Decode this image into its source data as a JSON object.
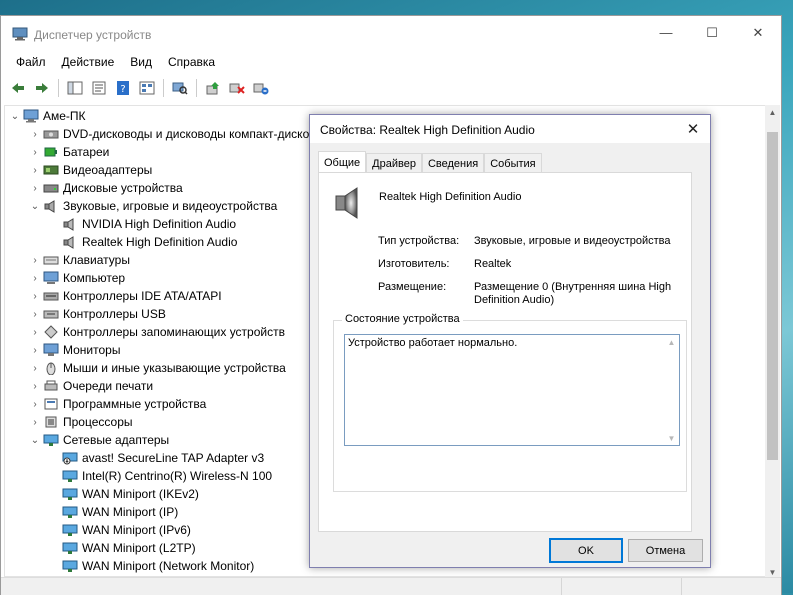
{
  "window": {
    "title": "Диспетчер устройств",
    "controls": {
      "minimize": "—",
      "maximize": "☐",
      "close": "✕"
    }
  },
  "menu": [
    "Файл",
    "Действие",
    "Вид",
    "Справка"
  ],
  "toolbar_icons": [
    "back-icon",
    "forward-icon",
    "show-hide-tree-icon",
    "properties-icon",
    "help-icon",
    "view-icon",
    "scan-hardware-icon",
    "update-driver-icon",
    "disable-device-icon",
    "uninstall-device-icon"
  ],
  "tree": {
    "root": "Аме-ПК",
    "items": [
      {
        "label": "DVD-дисководы и дисководы компакт-дисков",
        "level": 1,
        "expander": "›",
        "icon": "dvd-icon"
      },
      {
        "label": "Батареи",
        "level": 1,
        "expander": "›",
        "icon": "battery-icon"
      },
      {
        "label": "Видеоадаптеры",
        "level": 1,
        "expander": "›",
        "icon": "display-adapter-icon"
      },
      {
        "label": "Дисковые устройства",
        "level": 1,
        "expander": "›",
        "icon": "disk-drive-icon"
      },
      {
        "label": "Звуковые, игровые и видеоустройства",
        "level": 1,
        "expander": "⌄",
        "icon": "sound-icon"
      },
      {
        "label": "NVIDIA High Definition Audio",
        "level": 2,
        "expander": "",
        "icon": "speaker-icon"
      },
      {
        "label": "Realtek High Definition Audio",
        "level": 2,
        "expander": "",
        "icon": "speaker-icon"
      },
      {
        "label": "Клавиатуры",
        "level": 1,
        "expander": "›",
        "icon": "keyboard-icon"
      },
      {
        "label": "Компьютер",
        "level": 1,
        "expander": "›",
        "icon": "computer-icon"
      },
      {
        "label": "Контроллеры IDE ATA/ATAPI",
        "level": 1,
        "expander": "›",
        "icon": "ide-controller-icon"
      },
      {
        "label": "Контроллеры USB",
        "level": 1,
        "expander": "›",
        "icon": "usb-icon"
      },
      {
        "label": "Контроллеры запоминающих устройств",
        "level": 1,
        "expander": "›",
        "icon": "storage-controller-icon"
      },
      {
        "label": "Мониторы",
        "level": 1,
        "expander": "›",
        "icon": "monitor-icon"
      },
      {
        "label": "Мыши и иные указывающие устройства",
        "level": 1,
        "expander": "›",
        "icon": "mouse-icon"
      },
      {
        "label": "Очереди печати",
        "level": 1,
        "expander": "›",
        "icon": "printer-icon"
      },
      {
        "label": "Программные устройства",
        "level": 1,
        "expander": "›",
        "icon": "software-device-icon"
      },
      {
        "label": "Процессоры",
        "level": 1,
        "expander": "›",
        "icon": "processor-icon"
      },
      {
        "label": "Сетевые адаптеры",
        "level": 1,
        "expander": "⌄",
        "icon": "network-adapter-icon"
      },
      {
        "label": "avast! SecureLine TAP Adapter v3",
        "level": 2,
        "expander": "",
        "icon": "network-adapter-disabled-icon"
      },
      {
        "label": "Intel(R) Centrino(R) Wireless-N 100",
        "level": 2,
        "expander": "",
        "icon": "network-adapter-icon"
      },
      {
        "label": "WAN Miniport (IKEv2)",
        "level": 2,
        "expander": "",
        "icon": "network-adapter-icon"
      },
      {
        "label": "WAN Miniport (IP)",
        "level": 2,
        "expander": "",
        "icon": "network-adapter-icon"
      },
      {
        "label": "WAN Miniport (IPv6)",
        "level": 2,
        "expander": "",
        "icon": "network-adapter-icon"
      },
      {
        "label": "WAN Miniport (L2TP)",
        "level": 2,
        "expander": "",
        "icon": "network-adapter-icon"
      },
      {
        "label": "WAN Miniport (Network Monitor)",
        "level": 2,
        "expander": "",
        "icon": "network-adapter-icon"
      }
    ]
  },
  "dialog": {
    "title": "Свойства: Realtek High Definition Audio",
    "close": "✕",
    "tabs": [
      "Общие",
      "Драйвер",
      "Сведения",
      "События"
    ],
    "active_tab": "Общие",
    "device_name": "Realtek High Definition Audio",
    "props": [
      {
        "label": "Тип устройства:",
        "value": "Звуковые, игровые и видеоустройства"
      },
      {
        "label": "Изготовитель:",
        "value": "Realtek"
      },
      {
        "label": "Размещение:",
        "value": "Размещение 0 (Внутренняя шина High Definition Audio)"
      }
    ],
    "status_group": "Состояние устройства",
    "status_text": "Устройство работает нормально.",
    "ok": "OK",
    "cancel": "Отмена"
  }
}
